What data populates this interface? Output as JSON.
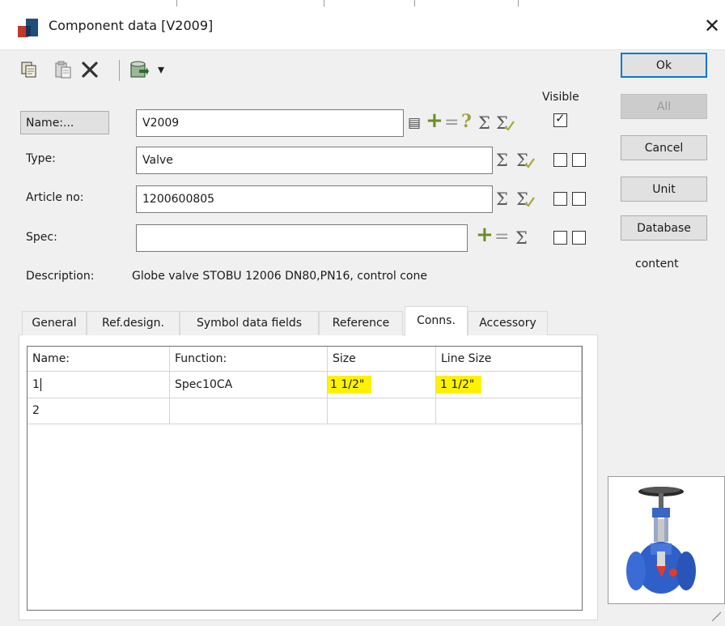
{
  "window": {
    "title": "Component data [V2009]",
    "close_glyph": "✕",
    "icon": "component-app-icon"
  },
  "toolbar": {
    "icons": [
      "copy-icon",
      "paste-icon",
      "delete-icon",
      "database-icon",
      "dropdown-arrow-icon"
    ],
    "dropdown_glyph": "▾"
  },
  "fields": {
    "name": {
      "label": "Name:...",
      "value": "V2009"
    },
    "type": {
      "label": "Type:",
      "value": "Valve"
    },
    "article": {
      "label": "Article no:",
      "value": "1200600805"
    },
    "spec": {
      "label": "Spec:",
      "value": ""
    },
    "visible_label": "Visible",
    "visible_checked": true
  },
  "description": {
    "label": "Description:",
    "text": "Globe valve STOBU 12006 DN80,PN16, control cone"
  },
  "glyphs": {
    "sigma": "Σ",
    "plus": "+",
    "minus": "=",
    "question": "?",
    "list": "▤"
  },
  "buttons": {
    "ok": "Ok",
    "all": "All",
    "cancel": "Cancel",
    "unit": "Unit",
    "database": "Database",
    "content": "content"
  },
  "tabs": [
    {
      "label": "General",
      "active": false
    },
    {
      "label": "Ref.design.",
      "active": false
    },
    {
      "label": "Symbol data fields",
      "active": false
    },
    {
      "label": "Reference",
      "active": false
    },
    {
      "label": "Conns.",
      "active": true
    },
    {
      "label": "Accessory",
      "active": false
    }
  ],
  "grid": {
    "columns": [
      "Name:",
      "Function:",
      "Size",
      "Line Size"
    ],
    "rows": [
      {
        "name": "1",
        "function": "Spec10CA",
        "size": "1 1/2\"",
        "line_size": "1 1/2\""
      },
      {
        "name": "2",
        "function": "",
        "size": "",
        "line_size": ""
      }
    ],
    "highlight_color": "#fff200"
  },
  "preview": {
    "icon": "globe-valve-image"
  },
  "colors": {
    "accent": "#0078d7",
    "sigma_gray": "#5b5b5b",
    "plus_green": "#6b8e23"
  }
}
